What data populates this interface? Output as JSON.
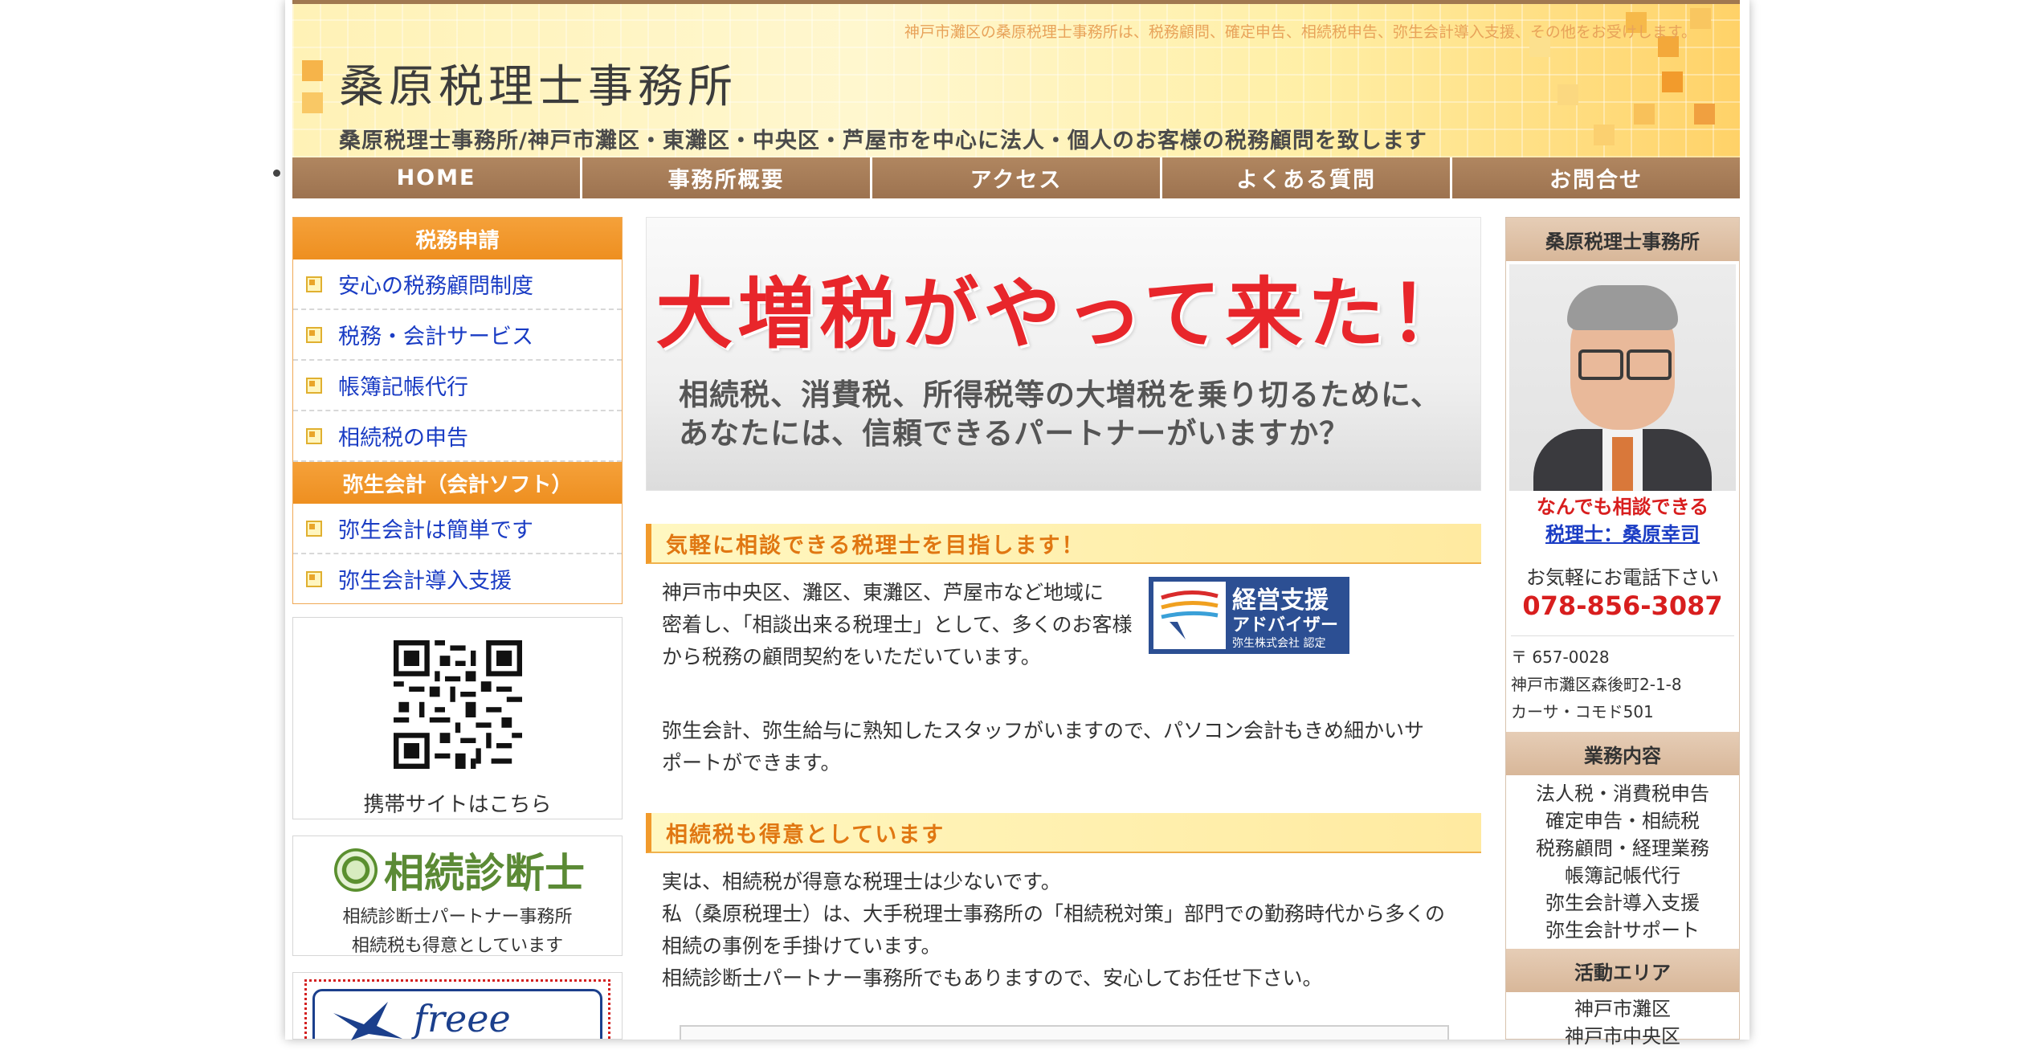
{
  "header": {
    "site_title": "桑原税理士事務所",
    "tagline": "神戸市灘区の桑原税理士事務所は、税務顧問、確定申告、相続税申告、弥生会計導入支援、その他をお受けします。",
    "subtitle": "桑原税理士事務所/神戸市灘区・東灘区・中央区・芦屋市を中心に法人・個人のお客様の税務顧問を致します"
  },
  "nav": [
    "HOME",
    "事務所概要",
    "アクセス",
    "よくある質問",
    "お問合せ"
  ],
  "left_sidebar": {
    "tax_head": "税務申請",
    "tax_links": [
      "安心の税務顧問制度",
      "税務・会計サービス",
      "帳簿記帳代行",
      "相続税の申告"
    ],
    "yayoi_head": "弥生会計（会計ソフト）",
    "yayoi_links": [
      "弥生会計は簡単です",
      "弥生会計導入支援"
    ],
    "mobile_caption": "携帯サイトはこちら",
    "souzoku_logo": "相続診断士",
    "souzoku_line1": "相続診断士パートナー事務所",
    "souzoku_line2": "相続税も得意としています",
    "freee_logo": "freee"
  },
  "hero": {
    "title": "大増税がやって来た！",
    "line1": "相続税、消費税、所得税等の大増税を乗り切るために、",
    "line2": "あなたには、信頼できるパートナーがいますか？"
  },
  "section1": {
    "heading": "気軽に相談できる税理士を目指します！",
    "p1_lines": [
      "神戸市中央区、灘区、東灘区、芦屋市など地域に",
      "密着し、「相談出来る税理士」として、多くのお客様",
      "から税務の顧問契約をいただいています。"
    ],
    "p2_lines": [
      "弥生会計、弥生給与に熟知したスタッフがいますので、パソコン会計もきめ細かいサ",
      "ポートができます。"
    ],
    "badge_title": "経営支援",
    "badge_sub": "アドバイザー",
    "badge_cert": "弥生株式会社 認定"
  },
  "section2": {
    "heading": "相続税も得意としています",
    "lines": [
      "実は、相続税が得意な税理士は少ないです。",
      "私（桑原税理士）は、大手税理士事務所の「相続税対策」部門での勤務時代から多くの",
      "相続の事例を手掛けています。",
      "相続診断士パートナー事務所でもありますので、安心してお任せ下さい。"
    ]
  },
  "right_sidebar": {
    "office_head": "桑原税理士事務所",
    "catch": "なんでも相談できる",
    "name_link": "税理士：桑原幸司",
    "phone_prompt": "お気軽にお電話下さい",
    "phone": "078-856-3087",
    "postal": "〒 657-0028",
    "address1": "神戸市灘区森後町2-1-8",
    "address2": "カーサ・コモド501",
    "services_head": "業務内容",
    "services": [
      "法人税・消費税申告",
      "確定申告・相続税",
      "税務顧問・経理業務",
      "帳簿記帳代行",
      "弥生会計導入支援",
      "弥生会計サポート"
    ],
    "area_head": "活動エリア",
    "areas": [
      "神戸市灘区",
      "神戸市中央区"
    ]
  },
  "colors": {
    "nav": "#a57b55",
    "orange_head": "#f19a2c",
    "hero_red": "#e8262b",
    "link_blue": "#1a3cc4",
    "phone_red": "#d81e1e"
  }
}
